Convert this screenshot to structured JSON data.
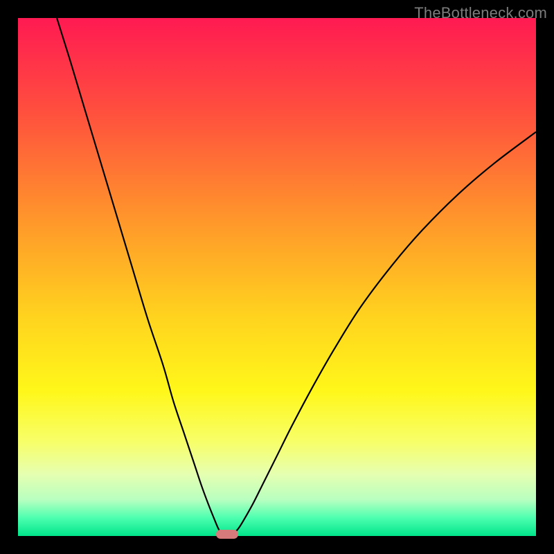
{
  "watermark": "TheBottleneck.com",
  "chart_data": {
    "type": "line",
    "title": "",
    "xlabel": "",
    "ylabel": "",
    "xlim": [
      0,
      100
    ],
    "ylim": [
      0,
      100
    ],
    "gradient_stops": [
      {
        "offset": 0.0,
        "color": "#ff1a52"
      },
      {
        "offset": 0.18,
        "color": "#ff4f3e"
      },
      {
        "offset": 0.4,
        "color": "#ff9a2a"
      },
      {
        "offset": 0.58,
        "color": "#ffd41e"
      },
      {
        "offset": 0.72,
        "color": "#fff71a"
      },
      {
        "offset": 0.82,
        "color": "#f7ff6a"
      },
      {
        "offset": 0.88,
        "color": "#e6ffb0"
      },
      {
        "offset": 0.93,
        "color": "#b8ffc0"
      },
      {
        "offset": 0.965,
        "color": "#4dffb0"
      },
      {
        "offset": 1.0,
        "color": "#00e58a"
      }
    ],
    "series": [
      {
        "name": "left-curve",
        "x": [
          7.5,
          10,
          13,
          16,
          19,
          22,
          25,
          28,
          30,
          32,
          34,
          35.5,
          36.8,
          37.8,
          38.5,
          39.0
        ],
        "values": [
          100,
          92,
          82,
          72,
          62,
          52,
          42,
          33,
          26,
          20,
          14,
          9.5,
          6.0,
          3.5,
          1.8,
          0.8
        ]
      },
      {
        "name": "right-curve",
        "x": [
          42.0,
          42.8,
          44,
          45.5,
          47.5,
          50,
          53,
          57,
          61,
          66,
          72,
          78,
          85,
          92,
          100
        ],
        "values": [
          0.8,
          1.8,
          3.8,
          6.5,
          10.5,
          15.5,
          21.5,
          29,
          36,
          44,
          52,
          59,
          66,
          72,
          78
        ]
      }
    ],
    "marker": {
      "x_start": 38.2,
      "x_end": 42.5,
      "y": 0.4,
      "color": "#d77a7c"
    }
  }
}
